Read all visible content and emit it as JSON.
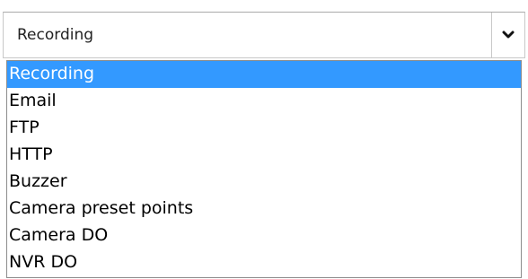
{
  "select": {
    "value": "Recording",
    "arrow_icon": "chevron-down-icon"
  },
  "options": [
    {
      "label": "Recording",
      "selected": true
    },
    {
      "label": "Email",
      "selected": false
    },
    {
      "label": "FTP",
      "selected": false
    },
    {
      "label": "HTTP",
      "selected": false
    },
    {
      "label": "Buzzer",
      "selected": false
    },
    {
      "label": "Camera preset points",
      "selected": false
    },
    {
      "label": "Camera DO",
      "selected": false
    },
    {
      "label": "NVR DO",
      "selected": false
    }
  ],
  "colors": {
    "highlight": "#3399ff",
    "highlight_text": "#ffffff",
    "border": "#c8c8c8"
  }
}
